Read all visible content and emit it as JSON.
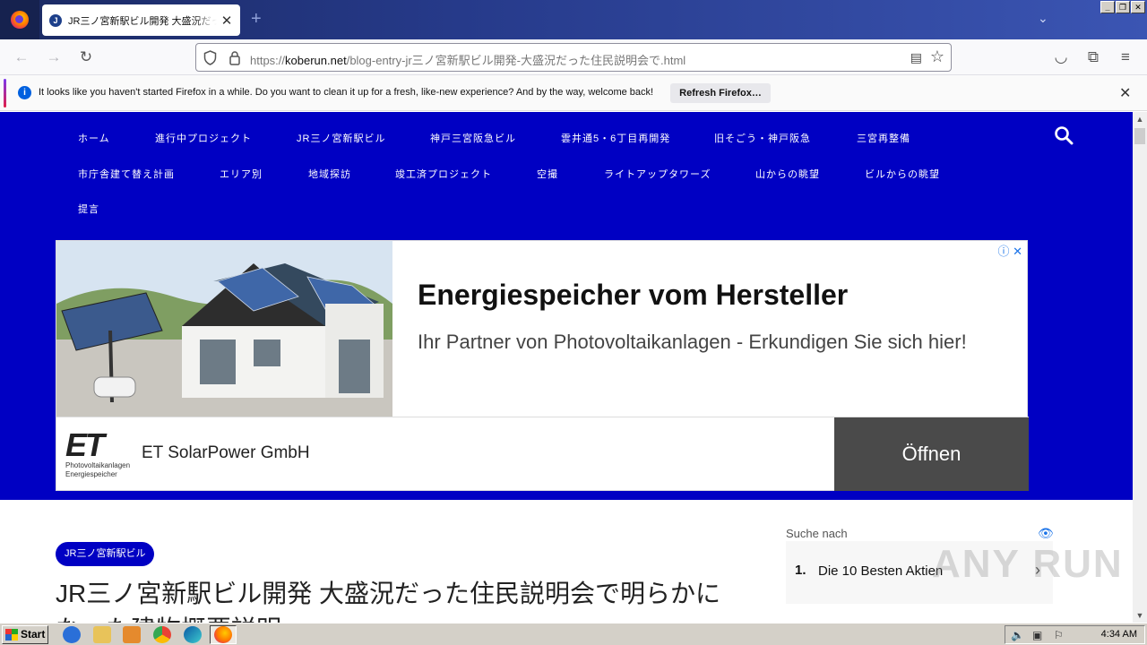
{
  "browser": {
    "tab_title": "JR三ノ宮新駅ビル開発 大盛況だった住民説明会で明らかになった建物概要説明",
    "tab_favicon": "J",
    "url_prefix": "https://",
    "url_host": "koberun.net",
    "url_path": "/blog-entry-jr三ノ宮新駅ビル開発-大盛況だった住民説明会で.html",
    "new_tab_label": "+",
    "tab_close": "✕"
  },
  "notification": {
    "message": "It looks like you haven't started Firefox in a while. Do you want to clean it up for a fresh, like-new experience? And by the way, welcome back!",
    "button": "Refresh Firefox…",
    "close": "✕"
  },
  "site_nav": {
    "items": [
      "ホーム",
      "進行中プロジェクト",
      "JR三ノ宮新駅ビル",
      "神戸三宮阪急ビル",
      "雲井通5・6丁目再開発",
      "旧そごう・神戸阪急",
      "三宮再整備",
      "市庁舎建て替え計画",
      "エリア別",
      "地域探訪",
      "竣工済プロジェクト",
      "空撮",
      "ライトアップタワーズ",
      "山からの眺望",
      "ビルからの眺望",
      "提言"
    ]
  },
  "ad": {
    "headline": "Energiespeicher vom Hersteller",
    "description": "Ihr Partner von Photovoltaikanlagen - Erkundigen Sie sich hier!",
    "logo_mark": "ET",
    "logo_sub_1": "Photovoltaikanlagen",
    "logo_sub_2": "Energiespeicher",
    "brand": "ET SolarPower GmbH",
    "cta": "Öffnen"
  },
  "article": {
    "category_tag": "JR三ノ宮新駅ビル",
    "title": "JR三ノ宮新駅ビル開発 大盛況だった住民説明会で明らかになった建物概要説明"
  },
  "sidebar": {
    "label": "Suche nach",
    "items": [
      {
        "num": "1.",
        "text": "Die 10 Besten Aktien"
      }
    ]
  },
  "watermark": "ANY RUN",
  "taskbar": {
    "start": "Start",
    "clock": "4:34 AM"
  },
  "colors": {
    "site_nav_bg": "#0000c3",
    "ad_cta_bg": "#4a4a4a"
  }
}
